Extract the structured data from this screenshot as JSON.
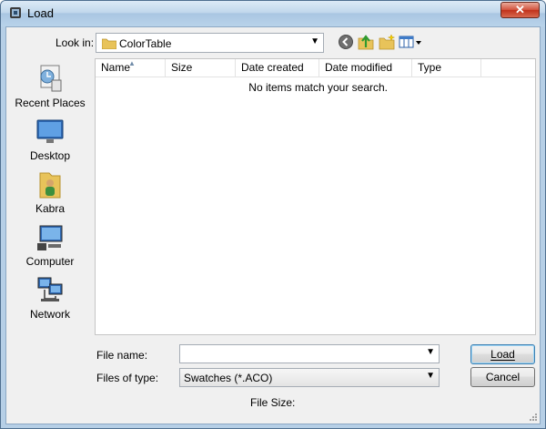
{
  "window": {
    "title": "Load",
    "close_label": "✕"
  },
  "toolbar": {
    "lookin_label": "Look in:",
    "lookin_value": "ColorTable",
    "icons": [
      "back-icon",
      "up-folder-icon",
      "new-folder-icon",
      "view-menu-icon"
    ]
  },
  "places": [
    {
      "label": "Recent Places",
      "icon": "recent-places-icon"
    },
    {
      "label": "Desktop",
      "icon": "desktop-icon"
    },
    {
      "label": "Kabra",
      "icon": "user-folder-icon"
    },
    {
      "label": "Computer",
      "icon": "computer-icon"
    },
    {
      "label": "Network",
      "icon": "network-icon"
    }
  ],
  "filelist": {
    "columns": [
      "Name",
      "Size",
      "Date created",
      "Date modified",
      "Type"
    ],
    "empty_message": "No items match your search."
  },
  "form": {
    "filename_label": "File name:",
    "filename_value": "",
    "filetype_label": "Files of type:",
    "filetype_value": "Swatches (*.ACO)",
    "load_label": "Load",
    "cancel_label": "Cancel",
    "filesize_label": "File Size:"
  }
}
